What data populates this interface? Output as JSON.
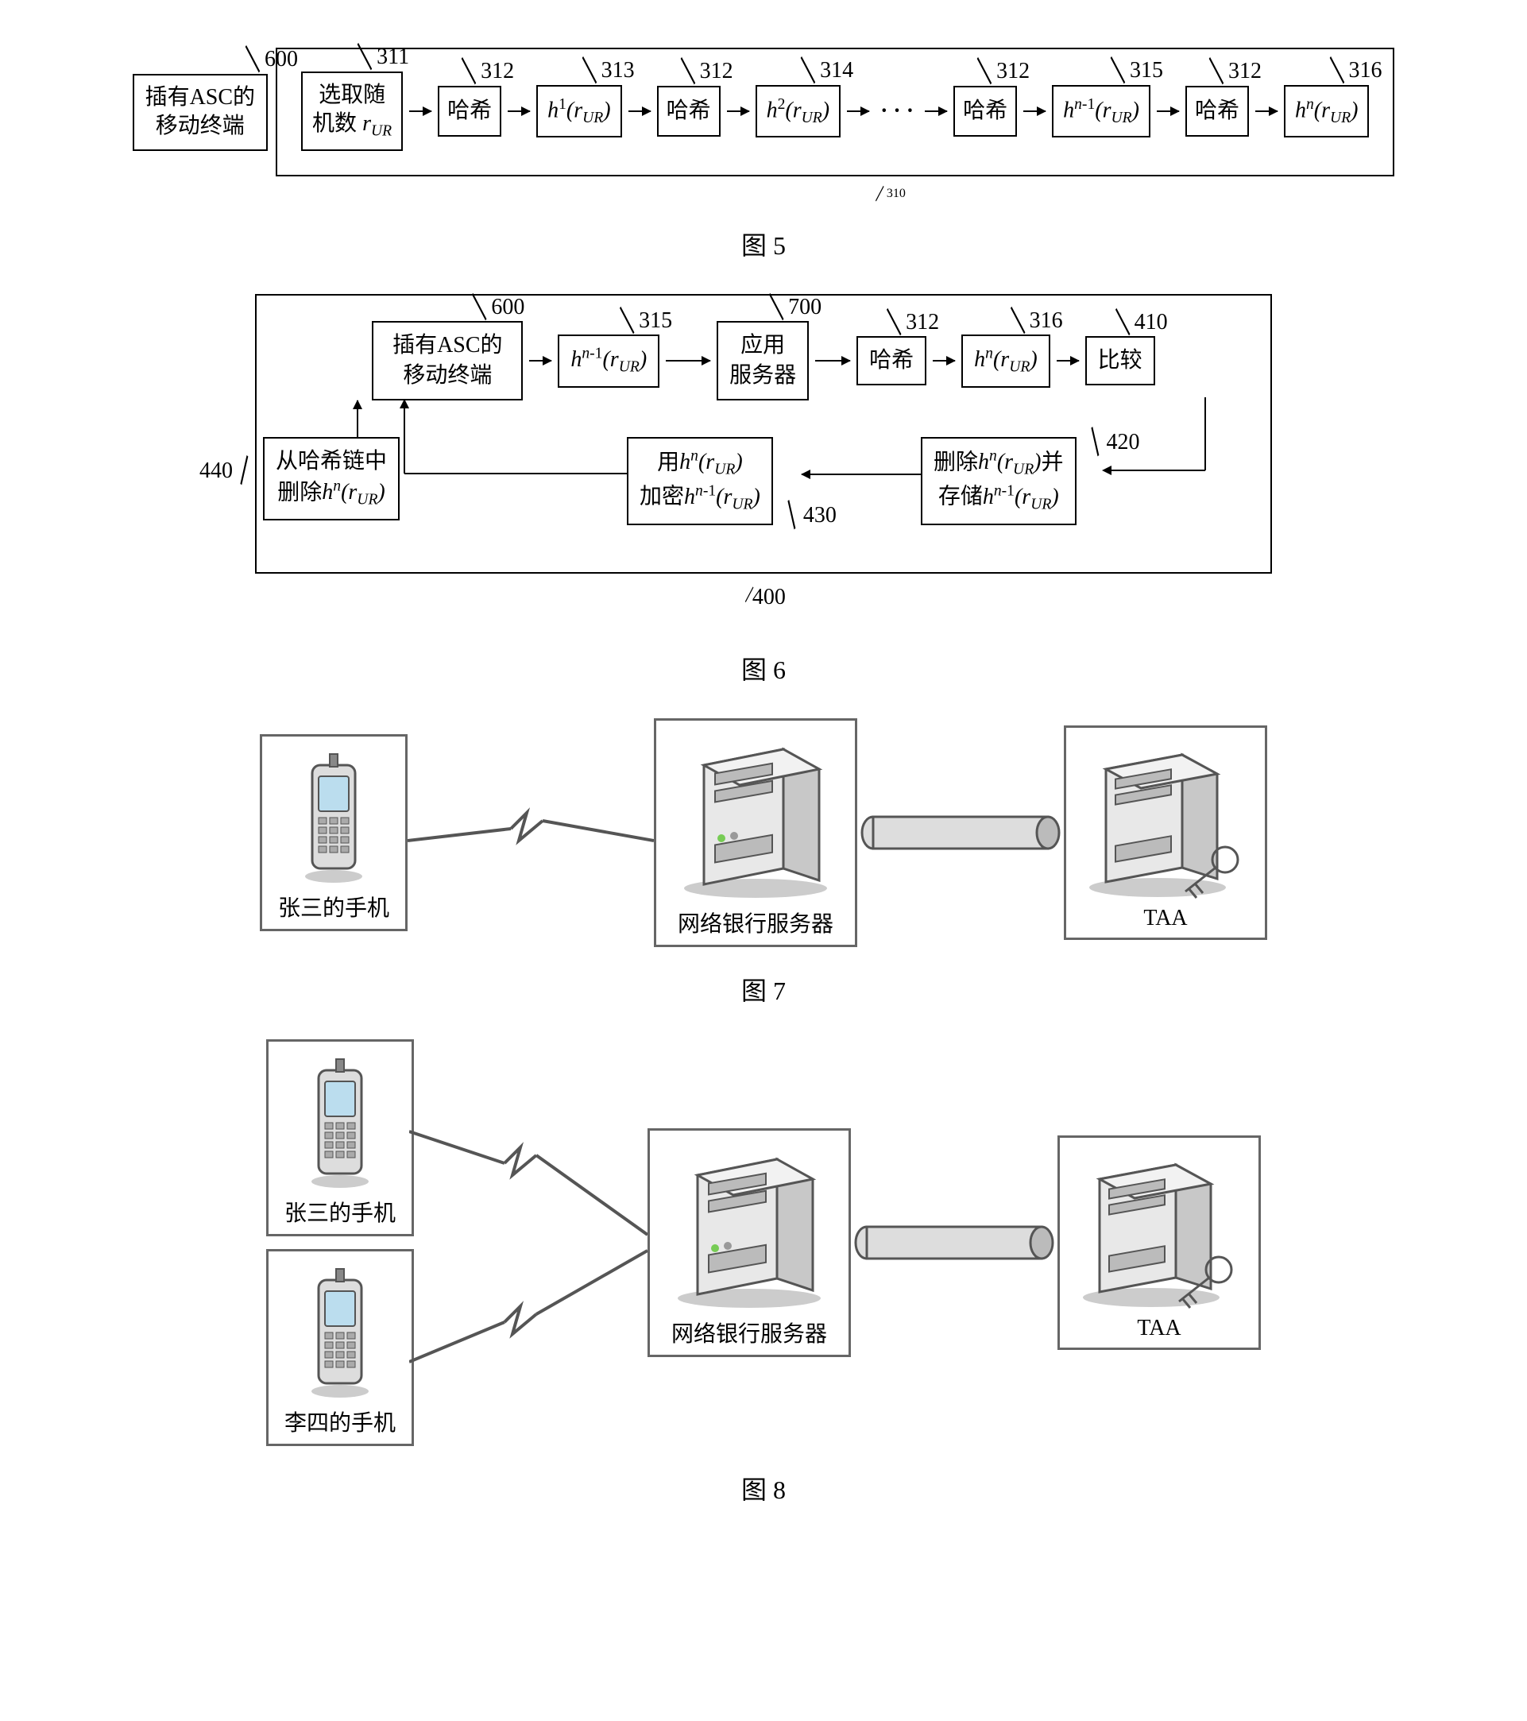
{
  "fig5": {
    "caption": "图 5",
    "chain_label": "310",
    "left_box": {
      "label": "600",
      "text": "插有ASC的\n移动终端"
    },
    "boxes": [
      {
        "label": "311",
        "text": "选取随\n机数 r_{UR}"
      },
      {
        "label": "312",
        "text": "哈希"
      },
      {
        "label": "313",
        "text": "h^{1}(r_{UR})"
      },
      {
        "label": "312",
        "text": "哈希"
      },
      {
        "label": "314",
        "text": "h^{2}(r_{UR})"
      },
      {
        "label": "312",
        "text": "哈希"
      },
      {
        "label": "315",
        "text": "h^{n-1}(r_{UR})"
      },
      {
        "label": "312",
        "text": "哈希"
      },
      {
        "label": "316",
        "text": "h^{n}(r_{UR})"
      }
    ]
  },
  "fig6": {
    "caption": "图 6",
    "wrapper_label": "400",
    "row1": [
      {
        "label": "600",
        "text": "插有ASC的\n移动终端"
      },
      {
        "label": "315",
        "text": "h^{n-1}(r_{UR})"
      },
      {
        "label": "700",
        "text": "应用\n服务器"
      },
      {
        "label": "312",
        "text": "哈希"
      },
      {
        "label": "316",
        "text": "h^{n}(r_{UR})"
      },
      {
        "label": "410",
        "text": "比较"
      }
    ],
    "row2": [
      {
        "label": "440",
        "text": "从哈希链中\n删除h^{n}(r_{UR})"
      },
      {
        "label": "430",
        "text": "用h^{n}(r_{UR})\n加密h^{n-1}(r_{UR})"
      },
      {
        "label": "420",
        "text": "删除h^{n}(r_{UR})并\n存储h^{n-1}(r_{UR})"
      }
    ]
  },
  "fig7": {
    "caption": "图 7",
    "phone": "张三的手机",
    "server": "网络银行服务器",
    "taa": "TAA"
  },
  "fig8": {
    "caption": "图 8",
    "phone1": "张三的手机",
    "phone2": "李四的手机",
    "server": "网络银行服务器",
    "taa": "TAA"
  }
}
